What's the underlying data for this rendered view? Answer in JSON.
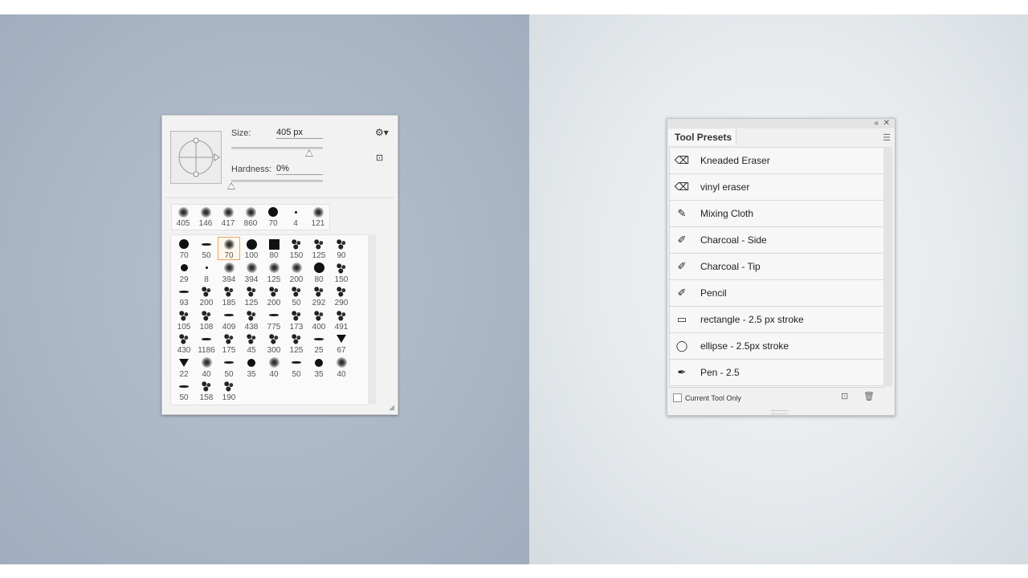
{
  "brush_picker": {
    "size_label": "Size:",
    "size_value": "405 px",
    "size_fraction": 0.85,
    "hardness_label": "Hardness:",
    "hardness_value": "0%",
    "hardness_fraction": 0.0,
    "recent_brushes": [
      {
        "size": "405",
        "kind": "soft"
      },
      {
        "size": "146",
        "kind": "soft"
      },
      {
        "size": "417",
        "kind": "soft"
      },
      {
        "size": "860",
        "kind": "soft"
      },
      {
        "size": "70",
        "kind": "hard"
      },
      {
        "size": "4",
        "kind": "dot"
      },
      {
        "size": "121",
        "kind": "soft"
      }
    ],
    "brushes": [
      {
        "size": "70",
        "kind": "hard"
      },
      {
        "size": "50",
        "kind": "stroke"
      },
      {
        "size": "70",
        "kind": "soft",
        "selected": true
      },
      {
        "size": "100",
        "kind": "hard"
      },
      {
        "size": "80",
        "kind": "square"
      },
      {
        "size": "150",
        "kind": "tex"
      },
      {
        "size": "125",
        "kind": "tex"
      },
      {
        "size": "90",
        "kind": "tex"
      },
      {
        "size": "29",
        "kind": "hard"
      },
      {
        "size": "8",
        "kind": "dot"
      },
      {
        "size": "394",
        "kind": "soft"
      },
      {
        "size": "394",
        "kind": "soft"
      },
      {
        "size": "125",
        "kind": "soft"
      },
      {
        "size": "200",
        "kind": "soft"
      },
      {
        "size": "80",
        "kind": "hard"
      },
      {
        "size": "150",
        "kind": "tex"
      },
      {
        "size": "93",
        "kind": "stroke"
      },
      {
        "size": "200",
        "kind": "tex"
      },
      {
        "size": "185",
        "kind": "tex"
      },
      {
        "size": "125",
        "kind": "tex"
      },
      {
        "size": "200",
        "kind": "tex"
      },
      {
        "size": "50",
        "kind": "tex"
      },
      {
        "size": "292",
        "kind": "tex"
      },
      {
        "size": "290",
        "kind": "tex"
      },
      {
        "size": "105",
        "kind": "tex"
      },
      {
        "size": "108",
        "kind": "tex"
      },
      {
        "size": "409",
        "kind": "stroke"
      },
      {
        "size": "438",
        "kind": "tex"
      },
      {
        "size": "775",
        "kind": "stroke"
      },
      {
        "size": "173",
        "kind": "tex"
      },
      {
        "size": "400",
        "kind": "tex"
      },
      {
        "size": "491",
        "kind": "tex"
      },
      {
        "size": "430",
        "kind": "tex"
      },
      {
        "size": "1186",
        "kind": "stroke"
      },
      {
        "size": "175",
        "kind": "tex"
      },
      {
        "size": "45",
        "kind": "tex"
      },
      {
        "size": "300",
        "kind": "tex"
      },
      {
        "size": "125",
        "kind": "tex"
      },
      {
        "size": "25",
        "kind": "stroke"
      },
      {
        "size": "67",
        "kind": "tri"
      },
      {
        "size": "22",
        "kind": "tri"
      },
      {
        "size": "40",
        "kind": "soft"
      },
      {
        "size": "50",
        "kind": "stroke"
      },
      {
        "size": "35",
        "kind": "hard"
      },
      {
        "size": "40",
        "kind": "soft"
      },
      {
        "size": "50",
        "kind": "stroke"
      },
      {
        "size": "35",
        "kind": "hard"
      },
      {
        "size": "40",
        "kind": "soft"
      },
      {
        "size": "50",
        "kind": "stroke"
      },
      {
        "size": "158",
        "kind": "tex"
      },
      {
        "size": "190",
        "kind": "tex"
      }
    ]
  },
  "tool_presets": {
    "title": "Tool Presets",
    "items": [
      {
        "label": "Kneaded Eraser",
        "icon": "eraser-icon",
        "glyph": "⌫"
      },
      {
        "label": "vinyl eraser",
        "icon": "eraser-icon",
        "glyph": "⌫"
      },
      {
        "label": "Mixing Cloth",
        "icon": "mixer-brush-icon",
        "glyph": "✎"
      },
      {
        "label": "Charcoal - Side",
        "icon": "brush-icon",
        "glyph": "✐"
      },
      {
        "label": "Charcoal - Tip",
        "icon": "brush-icon",
        "glyph": "✐"
      },
      {
        "label": "Pencil",
        "icon": "brush-icon",
        "glyph": "✐"
      },
      {
        "label": "rectangle - 2.5 px stroke",
        "icon": "rectangle-icon",
        "glyph": "▭"
      },
      {
        "label": "ellipse - 2.5px stroke",
        "icon": "ellipse-icon",
        "glyph": "◯"
      },
      {
        "label": "Pen - 2.5",
        "icon": "pen-icon",
        "glyph": "✒"
      }
    ],
    "current_tool_only_label": "Current Tool Only",
    "current_tool_only_checked": false
  }
}
